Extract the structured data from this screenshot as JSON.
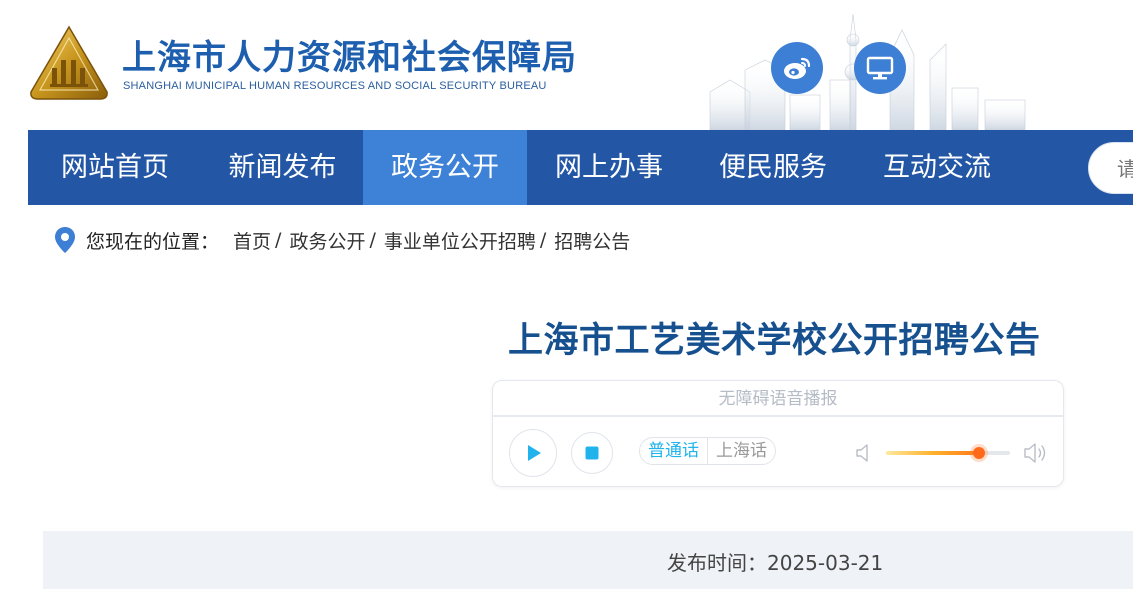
{
  "header": {
    "title": "上海市人力资源和社会保障局",
    "subtitle": "SHANGHAI MUNICIPAL HUMAN RESOURCES AND SOCIAL SECURITY BUREAU",
    "icons": [
      "weibo-icon",
      "desktop-icon"
    ],
    "brand_color": "#1d5fae"
  },
  "nav": {
    "items": [
      {
        "label": "网站首页"
      },
      {
        "label": "新闻发布"
      },
      {
        "label": "政务公开"
      },
      {
        "label": "网上办事"
      },
      {
        "label": "便民服务"
      },
      {
        "label": "互动交流"
      }
    ],
    "active_index": 2,
    "search_placeholder": "请",
    "bg_color": "#2357a6",
    "active_color": "#3e82d8"
  },
  "breadcrumb": {
    "label": "您现在的位置：",
    "items": [
      "首页",
      "政务公开",
      "事业单位公开招聘",
      "招聘公告"
    ],
    "separator": "/"
  },
  "article": {
    "title": "上海市工艺美术学校公开招聘公告",
    "publish_label": "发布时间：",
    "publish_date": "2025-03-21"
  },
  "player": {
    "title": "无障碍语音播报",
    "languages": [
      "普通话",
      "上海话"
    ],
    "selected_language": "普通话",
    "volume_percent": 75,
    "accent_color": "#21b4ec"
  }
}
